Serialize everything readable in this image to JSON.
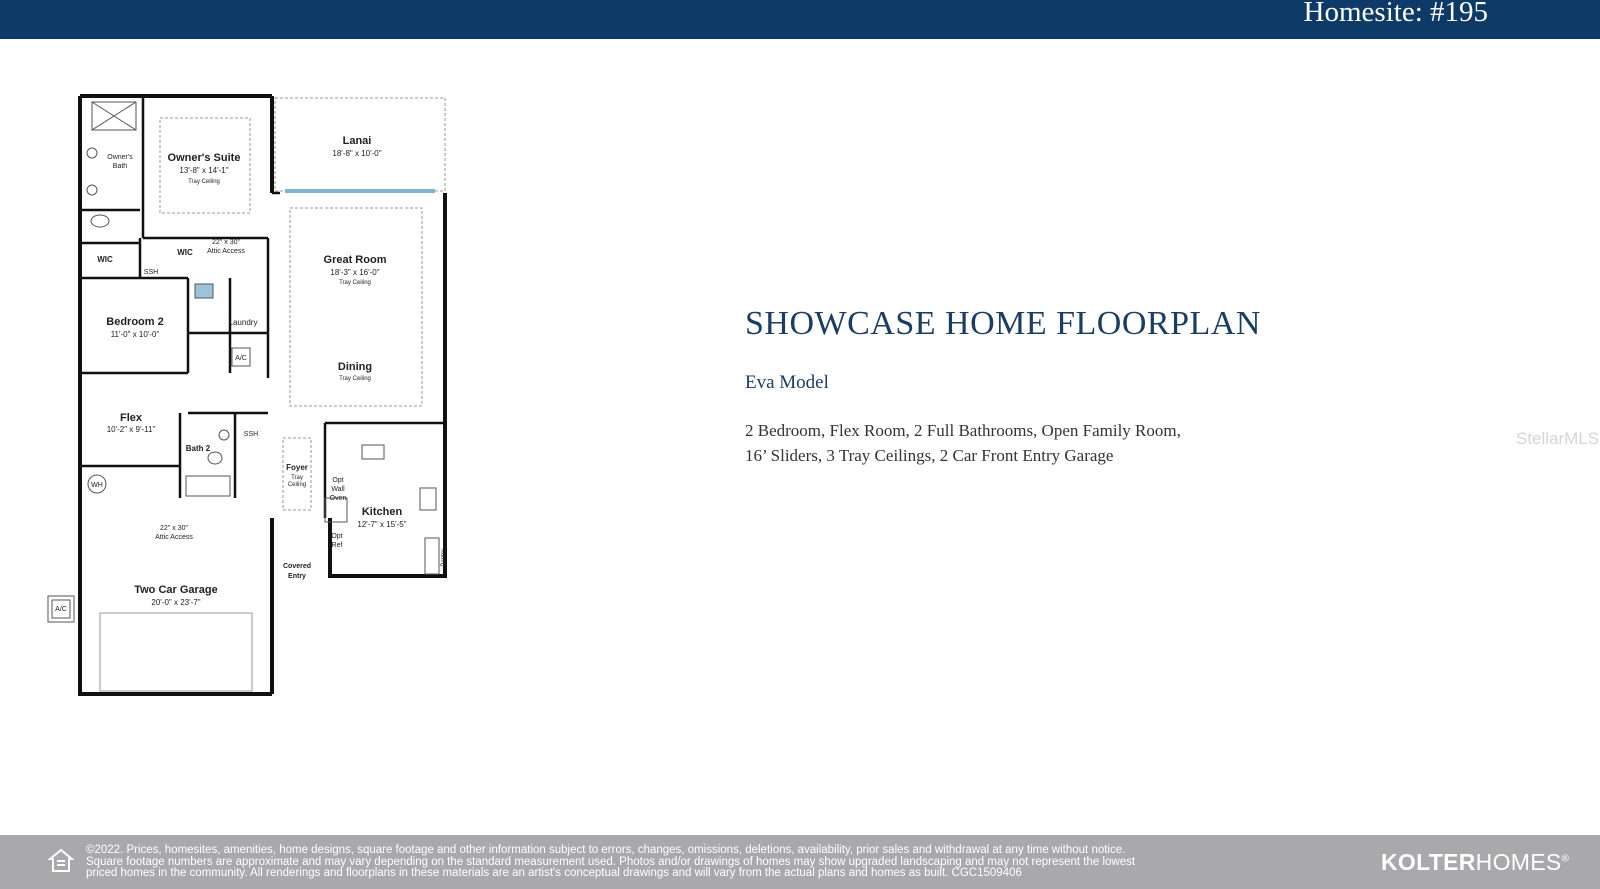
{
  "header": {
    "homesite": "Homesite: #195"
  },
  "floorplan": {
    "rooms": {
      "lanai": {
        "name": "Lanai",
        "dims": "18'-8\" x 10'-0\""
      },
      "owners_suite": {
        "name": "Owner's Suite",
        "dims": "13'-8\" x 14'-1\"",
        "note": "Tray Ceiling"
      },
      "owners_bath": {
        "line1": "Owner's",
        "line2": "Bath"
      },
      "wic_owner": {
        "name": "WIC"
      },
      "wic_small": {
        "name": "WIC"
      },
      "attic_top": {
        "line1": "22\" x 30\"",
        "line2": "Attic Access"
      },
      "ssh_top": "SSH",
      "great_room": {
        "name": "Great Room",
        "dims": "18'-3\" x 16'-0\"",
        "note": "Tray Ceiling"
      },
      "bedroom2": {
        "name": "Bedroom 2",
        "dims": "11'-0\" x 10'-0\""
      },
      "laundry": {
        "name": "Laundry"
      },
      "ac_inside": "A/C",
      "dining": {
        "name": "Dining",
        "note": "Tray Ceiling"
      },
      "flex": {
        "name": "Flex",
        "dims": "10'-2\" x 9'-11\""
      },
      "ssh_mid": "SSH",
      "bath2": {
        "name": "Bath 2"
      },
      "foyer": {
        "name": "Foyer",
        "note1": "Tray",
        "note2": "Ceiling"
      },
      "opt_wall_oven": {
        "line1": "Opt",
        "line2": "Wall",
        "line3": "Oven"
      },
      "kitchen": {
        "name": "Kitchen",
        "dims": "12'-7\" x 15'-5\""
      },
      "opt_ref": {
        "line1": "Opt",
        "line2": "Ref"
      },
      "pantry": "Pantry",
      "wh": "WH",
      "attic_garage": {
        "line1": "22\" x 30\"",
        "line2": "Attic Access"
      },
      "covered_entry": {
        "line1": "Covered",
        "line2": "Entry"
      },
      "garage": {
        "name": "Two Car Garage",
        "dims": "20'-0\" x 23'-7\""
      },
      "ac_outside": "A/C"
    }
  },
  "info": {
    "title": "SHOWCASE HOME FLOORPLAN",
    "model": "Eva Model",
    "features_line1": "2 Bedroom, Flex Room,  2 Full Bathrooms, Open Family Room,",
    "features_line2": "16’ Sliders, 3 Tray Ceilings, 2 Car Front Entry Garage"
  },
  "watermark": "StellarMLS",
  "footer": {
    "legal_line1": "©2022. Prices, homesites, amenities, home designs, square footage and other information subject to errors, changes, omissions, deletions, availability, prior sales and withdrawal at any time without notice.",
    "legal_line2": "Square footage numbers are approximate and may vary depending on the standard measurement used. Photos and/or drawings of homes may show upgraded landscaping and may not represent the lowest",
    "legal_line3": "priced homes in the community. All renderings and floorplans in these materials are an artist's conceptual drawings and will vary from the actual plans and homes as built. CGC1509406",
    "brand_bold": "KOLTER",
    "brand_light": "HOMES",
    "brand_mark": "®"
  },
  "colors": {
    "header_bg": "#0d3a66",
    "title_color": "#1c3d63",
    "footer_bg": "#a9a9ab"
  }
}
